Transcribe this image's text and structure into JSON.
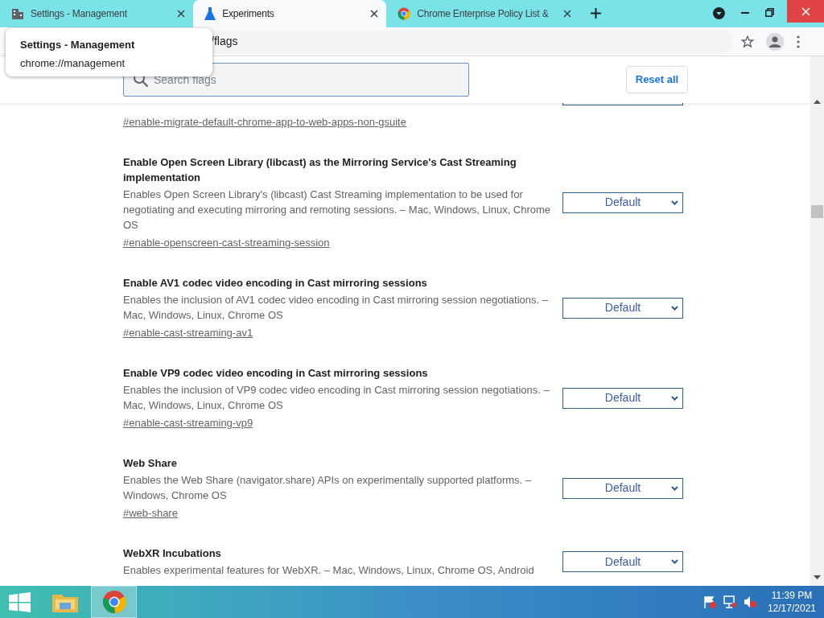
{
  "tabs": [
    {
      "title": "Settings - Management",
      "selected": false
    },
    {
      "title": "Experiments",
      "selected": true
    },
    {
      "title": "Chrome Enterprise Policy List &",
      "selected": false
    }
  ],
  "tooltip": {
    "title": "Settings - Management",
    "url": "chrome://management"
  },
  "address": "/flags",
  "search": {
    "placeholder": "Search flags"
  },
  "reset_button": "Reset all",
  "flags": [
    {
      "link": "#enable-migrate-default-chrome-app-to-web-apps-non-gsuite"
    },
    {
      "title": "Enable Open Screen Library (libcast) as the Mirroring Service's Cast Streaming implementation",
      "description": "Enables Open Screen Library's (libcast) Cast Streaming implementation to be used for negotiating and executing mirroring and remoting sessions. – Mac, Windows, Linux, Chrome OS",
      "link": "#enable-openscreen-cast-streaming-session",
      "value": "Default"
    },
    {
      "title": "Enable AV1 codec video encoding in Cast mirroring sessions",
      "description": "Enables the inclusion of AV1 codec video encoding in Cast mirroring session negotiations. – Mac, Windows, Linux, Chrome OS",
      "link": "#enable-cast-streaming-av1",
      "value": "Default"
    },
    {
      "title": "Enable VP9 codec video encoding in Cast mirroring sessions",
      "description": "Enables the inclusion of VP9 codec video encoding in Cast mirroring session negotiations. – Mac, Windows, Linux, Chrome OS",
      "link": "#enable-cast-streaming-vp9",
      "value": "Default"
    },
    {
      "title": "Web Share",
      "description": "Enables the Web Share (navigator.share) APIs on experimentally supported platforms. – Windows, Chrome OS",
      "link": "#web-share",
      "value": "Default"
    },
    {
      "title": "WebXR Incubations",
      "description": "Enables experimental features for WebXR. – Mac, Windows, Linux, Chrome OS, Android",
      "value": "Default"
    }
  ],
  "taskbar": {
    "time": "11:39 PM",
    "date": "12/17/2021"
  }
}
